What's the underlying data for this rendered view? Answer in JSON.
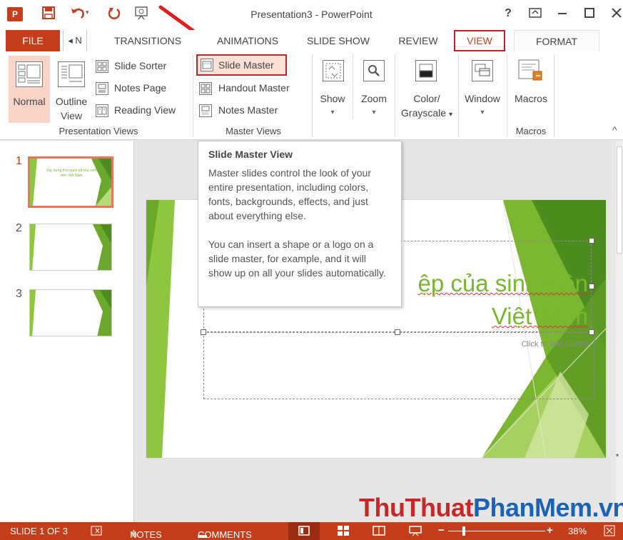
{
  "window": {
    "title": "Presentation3 - PowerPoint",
    "app_icon": "P",
    "help": "?",
    "buttons": [
      "restore-ribbon-icon",
      "minimize-icon",
      "maximize-icon",
      "close-icon"
    ]
  },
  "qat": {
    "icons": [
      "save-icon",
      "undo-icon",
      "redo-icon",
      "present-icon"
    ]
  },
  "tabs": {
    "file": "FILE",
    "scroll_left": "◂ N",
    "transitions": "TRANSITIONS",
    "animations": "ANIMATIONS",
    "slideshow": "SLIDE SHOW",
    "review": "REVIEW",
    "view": "VIEW",
    "format": "FORMAT"
  },
  "ribbon": {
    "presentation_views": {
      "label": "Presentation Views",
      "normal": "Normal",
      "outline_1": "Outline",
      "outline_2": "View",
      "slide_sorter": "Slide Sorter",
      "notes_page": "Notes Page",
      "reading_view": "Reading View"
    },
    "master_views": {
      "label": "Master Views",
      "slide_master": "Slide Master",
      "handout_master": "Handout Master",
      "notes_master": "Notes Master"
    },
    "show": {
      "label": "Show",
      "arrow": "▾"
    },
    "zoom": {
      "label": "Zoom",
      "arrow": "▾"
    },
    "color": {
      "label_1": "Color/",
      "label_2": "Grayscale",
      "arrow": "▾"
    },
    "window": {
      "label": "Window",
      "arrow": "▾"
    },
    "macros": {
      "label": "Macros",
      "group": "Macros"
    },
    "collapse": "^"
  },
  "thumbs": {
    "numbers": [
      "1",
      "2",
      "3"
    ],
    "thumb1_text": "Xây dựng thói quen tốt của sinh viên Việt Nam"
  },
  "tooltip": {
    "title": "Slide Master View",
    "para1": "Master slides control the look of your entire presentation, including colors, fonts, backgrounds, effects, and just about everything else.",
    "para2": "You can insert a shape or a logo on a slide master, for example, and it will show up on all your slides automatically."
  },
  "slide": {
    "title_line1": "ệp của sinh viên",
    "title_line2": "Việt Nam",
    "subtitle_placeholder": "Click to add subtitle"
  },
  "status": {
    "slide_info": "SLIDE 1 OF 3",
    "notes": "NOTES",
    "comments": "COMMENTS",
    "zoom_minus": "−",
    "zoom_plus": "+",
    "zoom_level": "38%"
  },
  "watermark": {
    "part1": "ThuThuat",
    "part2": "PhanMem",
    "part3": ".vn"
  },
  "colors": {
    "accent": "#c43e1c",
    "highlight_box": "#b02a2a",
    "slide_green": "#7ab630",
    "tooltip_border": "#c6c6c6"
  }
}
